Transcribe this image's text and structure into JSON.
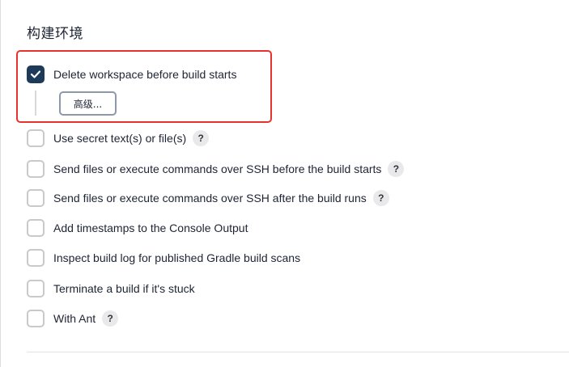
{
  "section": {
    "title": "构建环境"
  },
  "options": [
    {
      "label": "Delete workspace before build starts",
      "checked": true,
      "help": false
    },
    {
      "label": "Use secret text(s) or file(s)",
      "checked": false,
      "help": true
    },
    {
      "label": "Send files or execute commands over SSH before the build starts",
      "checked": false,
      "help": true
    },
    {
      "label": "Send files or execute commands over SSH after the build runs",
      "checked": false,
      "help": true
    },
    {
      "label": "Add timestamps to the Console Output",
      "checked": false,
      "help": false
    },
    {
      "label": "Inspect build log for published Gradle build scans",
      "checked": false,
      "help": false
    },
    {
      "label": "Terminate a build if it's stuck",
      "checked": false,
      "help": false
    },
    {
      "label": "With Ant",
      "checked": false,
      "help": true
    }
  ],
  "advanced": {
    "label": "高级..."
  },
  "help_glyph": "?",
  "colors": {
    "highlight": "#e8322d",
    "checkbox_checked": "#1d3a5a"
  }
}
